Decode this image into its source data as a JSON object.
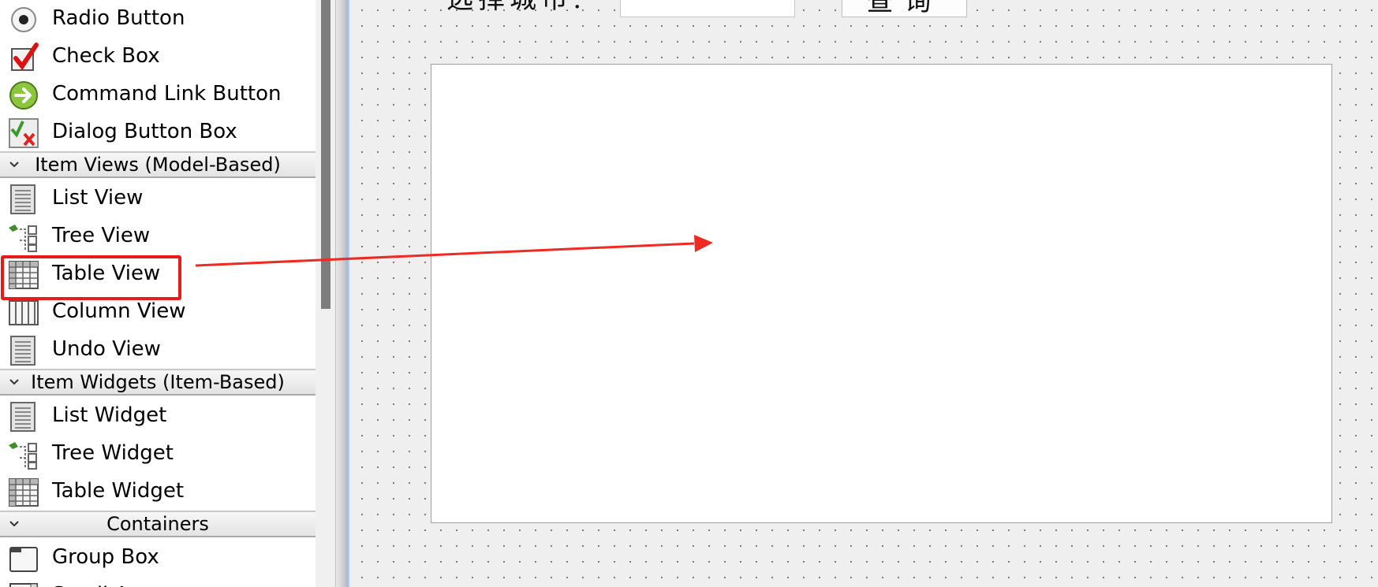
{
  "widget_box": {
    "groups": [
      {
        "kind": "item",
        "label": "Radio Button",
        "icon": "radio-button-icon"
      },
      {
        "kind": "item",
        "label": "Check Box",
        "icon": "check-box-icon"
      },
      {
        "kind": "item",
        "label": "Command Link Button",
        "icon": "command-link-button-icon"
      },
      {
        "kind": "item",
        "label": "Dialog Button Box",
        "icon": "dialog-button-box-icon"
      },
      {
        "kind": "category",
        "label": "Item Views (Model-Based)"
      },
      {
        "kind": "item",
        "label": "List View",
        "icon": "list-view-icon"
      },
      {
        "kind": "item",
        "label": "Tree View",
        "icon": "tree-view-icon"
      },
      {
        "kind": "item",
        "label": "Table View",
        "icon": "table-view-icon",
        "highlighted": true
      },
      {
        "kind": "item",
        "label": "Column View",
        "icon": "column-view-icon"
      },
      {
        "kind": "item",
        "label": "Undo View",
        "icon": "undo-view-icon"
      },
      {
        "kind": "category",
        "label": "Item Widgets (Item-Based)"
      },
      {
        "kind": "item",
        "label": "List Widget",
        "icon": "list-widget-icon"
      },
      {
        "kind": "item",
        "label": "Tree Widget",
        "icon": "tree-widget-icon"
      },
      {
        "kind": "item",
        "label": "Table Widget",
        "icon": "table-widget-icon"
      },
      {
        "kind": "category",
        "label": "Containers"
      },
      {
        "kind": "item",
        "label": "Group Box",
        "icon": "group-box-icon"
      },
      {
        "kind": "item",
        "label": "Scroll Area",
        "icon": "scroll-area-icon"
      }
    ]
  },
  "form": {
    "city_label": "选择城市:",
    "city_input_value": "",
    "query_button_label": "查询"
  },
  "colors": {
    "highlight": "#e81a1a",
    "arrow": "#ef2a22"
  }
}
